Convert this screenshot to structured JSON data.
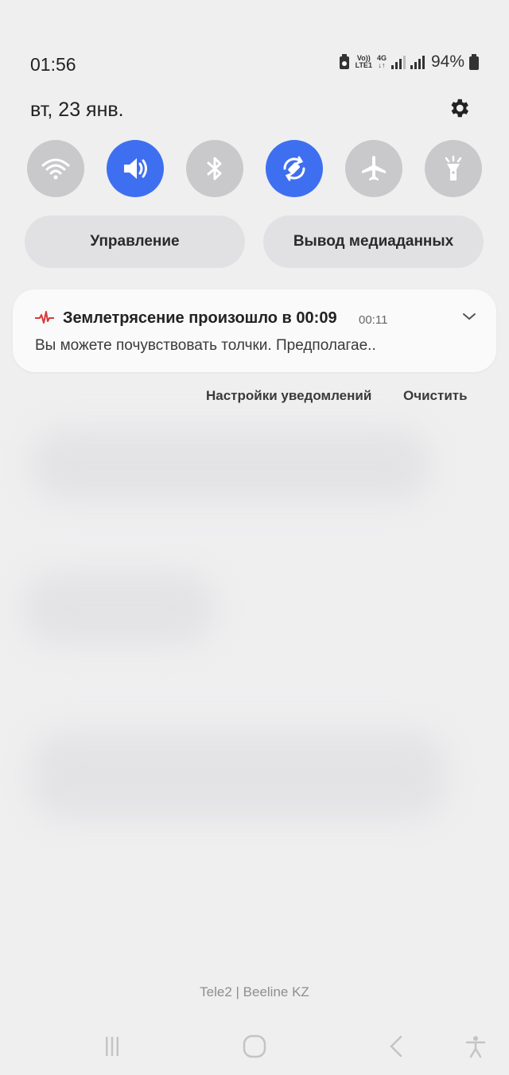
{
  "status": {
    "time": "01:56",
    "volte_top": "Vo))",
    "volte_bottom": "LTE1",
    "net_type": "4G",
    "battery_percent": "94%"
  },
  "header": {
    "date": "вт, 23 янв."
  },
  "quick_settings": [
    {
      "name": "wifi",
      "on": false
    },
    {
      "name": "sound",
      "on": true
    },
    {
      "name": "bluetooth",
      "on": false
    },
    {
      "name": "auto-rotate",
      "on": true
    },
    {
      "name": "airplane",
      "on": false
    },
    {
      "name": "flashlight",
      "on": false
    }
  ],
  "controls": {
    "device_control": "Управление",
    "media_output": "Вывод медиаданных"
  },
  "notification": {
    "title": "Землетрясение произошло в 00:09",
    "time": "00:11",
    "body": "Вы можете почувствовать толчки. Предполагае.."
  },
  "actions": {
    "settings": "Настройки уведомлений",
    "clear": "Очистить"
  },
  "carrier": "Tele2 | Beeline KZ",
  "colors": {
    "accent": "#3e6ff0",
    "quake_red": "#d93a3a"
  }
}
